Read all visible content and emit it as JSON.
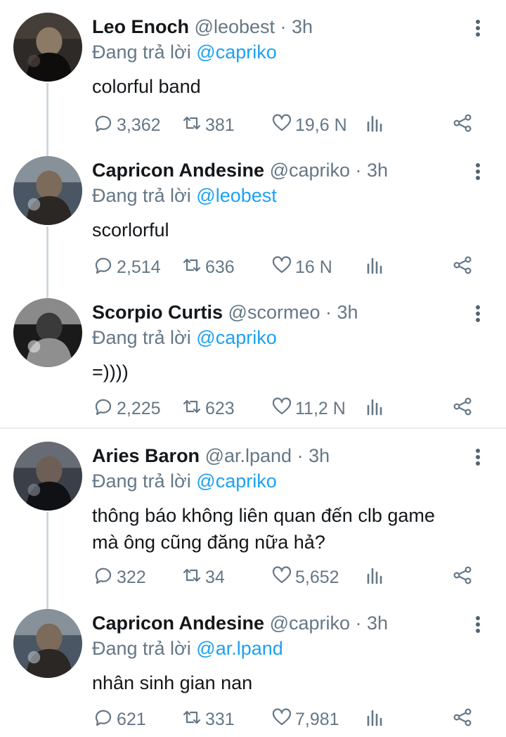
{
  "tweets": [
    {
      "name": "Leo Enoch",
      "handle": "@leobest",
      "time": "· 3h",
      "reply_prefix": "Đang trả lời",
      "reply_to": "@capriko",
      "text": [
        "colorful band"
      ],
      "replies": "3,362",
      "retweets": "381",
      "likes": "19,6 N",
      "avatar": "dark photo of a person sitting"
    },
    {
      "name": "Capricon Andesine",
      "handle": "@capriko",
      "time": "· 3h",
      "reply_prefix": "Đang trả lời",
      "reply_to": "@leobest",
      "text": [
        "scorlorful"
      ],
      "replies": "2,514",
      "retweets": "636",
      "likes": "16 N",
      "avatar": "person with hand on face, city background"
    },
    {
      "name": "Scorpio Curtis",
      "handle": "@scormeo",
      "time": "· 3h",
      "reply_prefix": "Đang trả lời",
      "reply_to": "@capriko",
      "text": [
        "=))))"
      ],
      "replies": "2,225",
      "retweets": "623",
      "likes": "11,2 N",
      "avatar": "person holding a cat"
    },
    {
      "name": "Aries Baron",
      "handle": "@ar.lpand",
      "time": "· 3h",
      "reply_prefix": "Đang trả lời",
      "reply_to": "@capriko",
      "text": [
        "thông báo không liên quan đến clb game",
        "mà ông cũng đăng nữa hả?"
      ],
      "replies": "322",
      "retweets": "34",
      "likes": "5,652",
      "avatar": "person on a street at night"
    },
    {
      "name": "Capricon Andesine",
      "handle": "@capriko",
      "time": "· 3h",
      "reply_prefix": "Đang trả lời",
      "reply_to": "@ar.lpand",
      "text": [
        "nhân sinh gian nan"
      ],
      "replies": "621",
      "retweets": "331",
      "likes": "7,981",
      "avatar": "person with hand on face, city background"
    }
  ],
  "icons": {
    "reply": "comment-bubble-icon",
    "retweet": "retweet-icon",
    "like": "heart-icon",
    "analytics": "bar-chart-icon",
    "share": "share-icon",
    "more": "vertical-dots-icon"
  },
  "colors": {
    "name": "#14171a",
    "meta": "#657786",
    "mention": "#1da1f2",
    "thread_line": "#cfd9de",
    "separator": "#e6ecf0"
  }
}
